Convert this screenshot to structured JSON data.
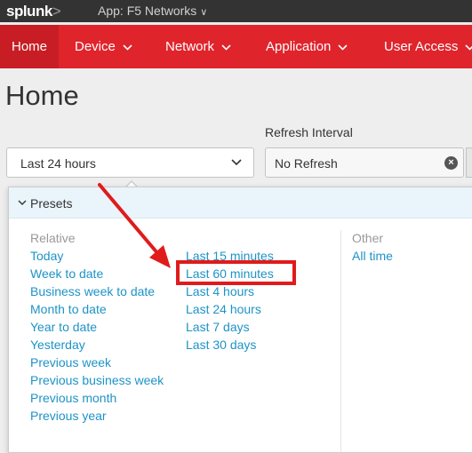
{
  "topbar": {
    "logo": "splunk",
    "logo_chevron": ">",
    "app_menu": "App: F5 Networks"
  },
  "nav": {
    "items": [
      {
        "label": "Home"
      },
      {
        "label": "Device"
      },
      {
        "label": "Network"
      },
      {
        "label": "Application"
      },
      {
        "label": "User Access"
      }
    ]
  },
  "page": {
    "title": "Home",
    "refresh_interval_label": "Refresh Interval",
    "time_picker_value": "Last 24 hours",
    "refresh_value": "No Refresh"
  },
  "presets": {
    "header": "Presets",
    "relative_heading": "Relative",
    "other_heading": "Other",
    "relative_col1": [
      "Today",
      "Week to date",
      "Business week to date",
      "Month to date",
      "Year to date",
      "Yesterday",
      "Previous week",
      "Previous business week",
      "Previous month",
      "Previous year"
    ],
    "relative_col2": [
      "Last 15 minutes",
      "Last 60 minutes",
      "Last 4 hours",
      "Last 24 hours",
      "Last 7 days",
      "Last 30 days"
    ],
    "other": [
      "All time"
    ]
  },
  "colors": {
    "nav_bg": "#e0242c",
    "link": "#1e93c6",
    "annotation": "#e01b1b"
  }
}
